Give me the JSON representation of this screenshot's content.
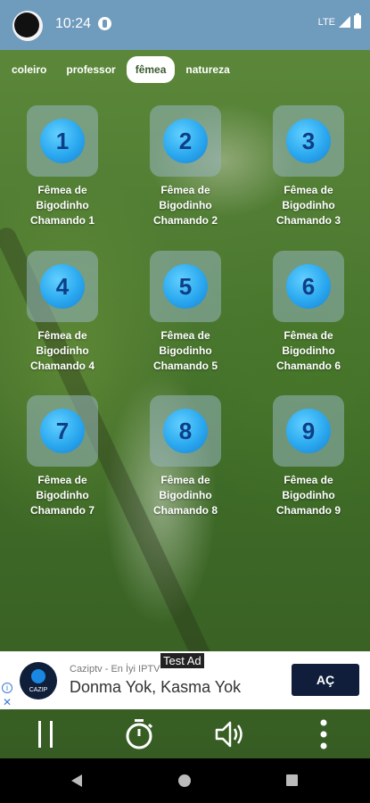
{
  "status_bar": {
    "time": "10:24",
    "network": "LTE",
    "icons": [
      "avatar-icon",
      "app-notification-icon",
      "signal-icon",
      "battery-icon"
    ]
  },
  "tabs": [
    {
      "label": "coleiro",
      "active": false
    },
    {
      "label": "professor",
      "active": false
    },
    {
      "label": "fêmea",
      "active": true
    },
    {
      "label": "natureza",
      "active": false
    }
  ],
  "items": [
    {
      "number": "1",
      "label_lines": [
        "Fêmea de",
        "Bigodinho",
        "Chamando 1"
      ]
    },
    {
      "number": "2",
      "label_lines": [
        "Fêmea de",
        "Bigodinho",
        "Chamando 2"
      ]
    },
    {
      "number": "3",
      "label_lines": [
        "Fêmea de",
        "Bigodinho",
        "Chamando 3"
      ]
    },
    {
      "number": "4",
      "label_lines": [
        "Fêmea de",
        "Bigodinho",
        "Chamando 4"
      ]
    },
    {
      "number": "5",
      "label_lines": [
        "Fêmea de",
        "Bigodinho",
        "Chamando 5"
      ]
    },
    {
      "number": "6",
      "label_lines": [
        "Fêmea de",
        "Bigodinho",
        "Chamando 6"
      ]
    },
    {
      "number": "7",
      "label_lines": [
        "Fêmea de",
        "Bigodinho",
        "Chamando 7"
      ]
    },
    {
      "number": "8",
      "label_lines": [
        "Fêmea de",
        "Bigodinho",
        "Chamando 8"
      ]
    },
    {
      "number": "9",
      "label_lines": [
        "Fêmea de",
        "Bigodinho",
        "Chamando 9"
      ]
    }
  ],
  "ad": {
    "test_label": "Test Ad",
    "logo_text": "CAZIP",
    "subtitle": "Cazіptv - En İyi IPTV",
    "title": "Donma Yok, Kasma Yok",
    "button": "AÇ"
  },
  "controls": {
    "icons": [
      "pause-icon",
      "timer-icon",
      "volume-icon",
      "more-vert-icon"
    ]
  },
  "nav": {
    "icons": [
      "back-icon",
      "home-icon",
      "recents-icon"
    ]
  },
  "colors": {
    "status_bar": "#6f9bbd",
    "number_circle": "#2aa8ef",
    "number_text": "#0d3f87",
    "ad_button": "#101e3b"
  }
}
